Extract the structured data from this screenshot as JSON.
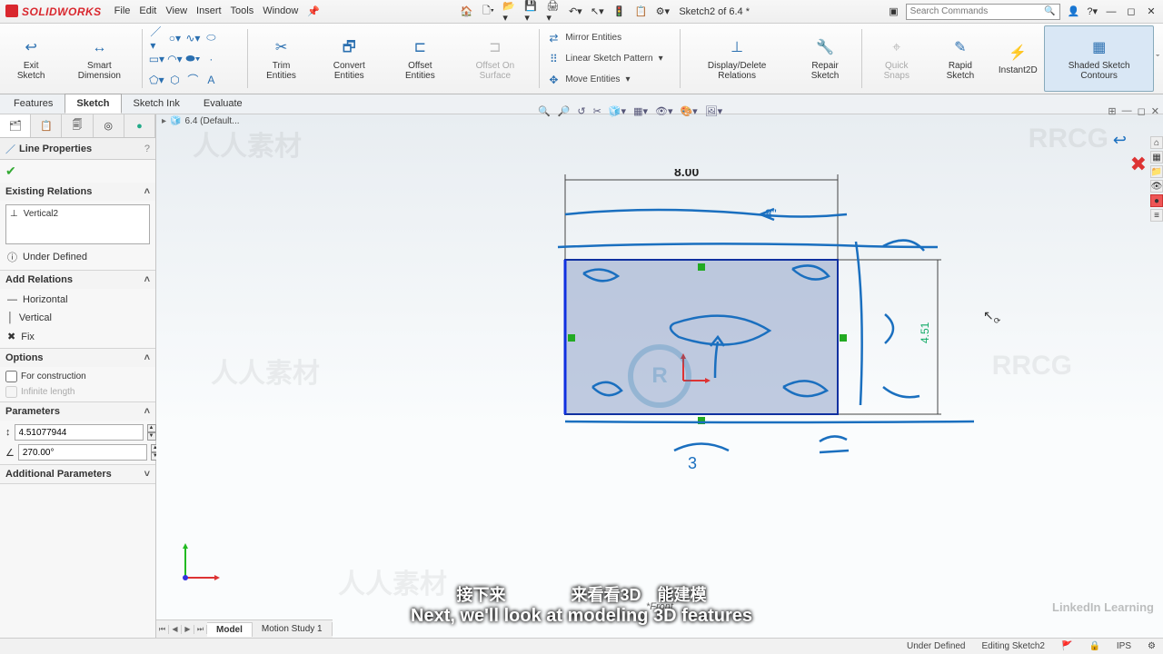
{
  "app": {
    "name": "SOLIDWORKS",
    "doc_title": "Sketch2 of 6.4 *"
  },
  "menu": [
    "File",
    "Edit",
    "View",
    "Insert",
    "Tools",
    "Window"
  ],
  "qat_icons": [
    "home-icon",
    "new-icon",
    "open-icon",
    "save-icon",
    "print-icon",
    "undo-icon",
    "redo-icon",
    "select-icon",
    "rebuild-icon",
    "options-icon",
    "settings-icon"
  ],
  "search": {
    "placeholder": "Search Commands"
  },
  "ribbon": {
    "exit": "Exit\nSketch",
    "smart_dim": "Smart\nDimension",
    "trim": "Trim\nEntities",
    "convert": "Convert\nEntities",
    "offset": "Offset\nEntities",
    "offset_surf": "Offset\nOn\nSurface",
    "mirror": "Mirror Entities",
    "pattern": "Linear Sketch Pattern",
    "move": "Move Entities",
    "disp_del": "Display/Delete\nRelations",
    "repair": "Repair\nSketch",
    "quick": "Quick\nSnaps",
    "rapid": "Rapid\nSketch",
    "instant": "Instant2D",
    "shaded": "Shaded\nSketch\nContours"
  },
  "tabs": [
    "Features",
    "Sketch",
    "Sketch Ink",
    "Evaluate"
  ],
  "active_tab": "Sketch",
  "tree_overlay": "6.4 (Default...",
  "property_panel": {
    "title": "Line Properties",
    "existing_hdr": "Existing Relations",
    "existing": "Vertical2",
    "state": "Under Defined",
    "add_hdr": "Add Relations",
    "add_items": [
      "Horizontal",
      "Vertical",
      "Fix"
    ],
    "options_hdr": "Options",
    "opt1": "For construction",
    "opt2": "Infinite length",
    "params_hdr": "Parameters",
    "param1": "4.51077944",
    "param2": "270.00°",
    "addl_hdr": "Additional Parameters"
  },
  "sketch": {
    "dim_top": "8.00",
    "dim_right": "4.51"
  },
  "view_label": "*Front",
  "bottom_tabs": [
    "Model",
    "Motion Study 1"
  ],
  "status": {
    "def": "Under Defined",
    "ctx": "Editing Sketch2",
    "units": "IPS"
  },
  "subtitle": {
    "zh": "接下来　　　　来看看3D　能建模",
    "en": "Next, we'll look at modeling 3D features"
  },
  "watermarks": [
    "人人素材",
    "RRCG"
  ],
  "li": "LinkedIn Learning"
}
